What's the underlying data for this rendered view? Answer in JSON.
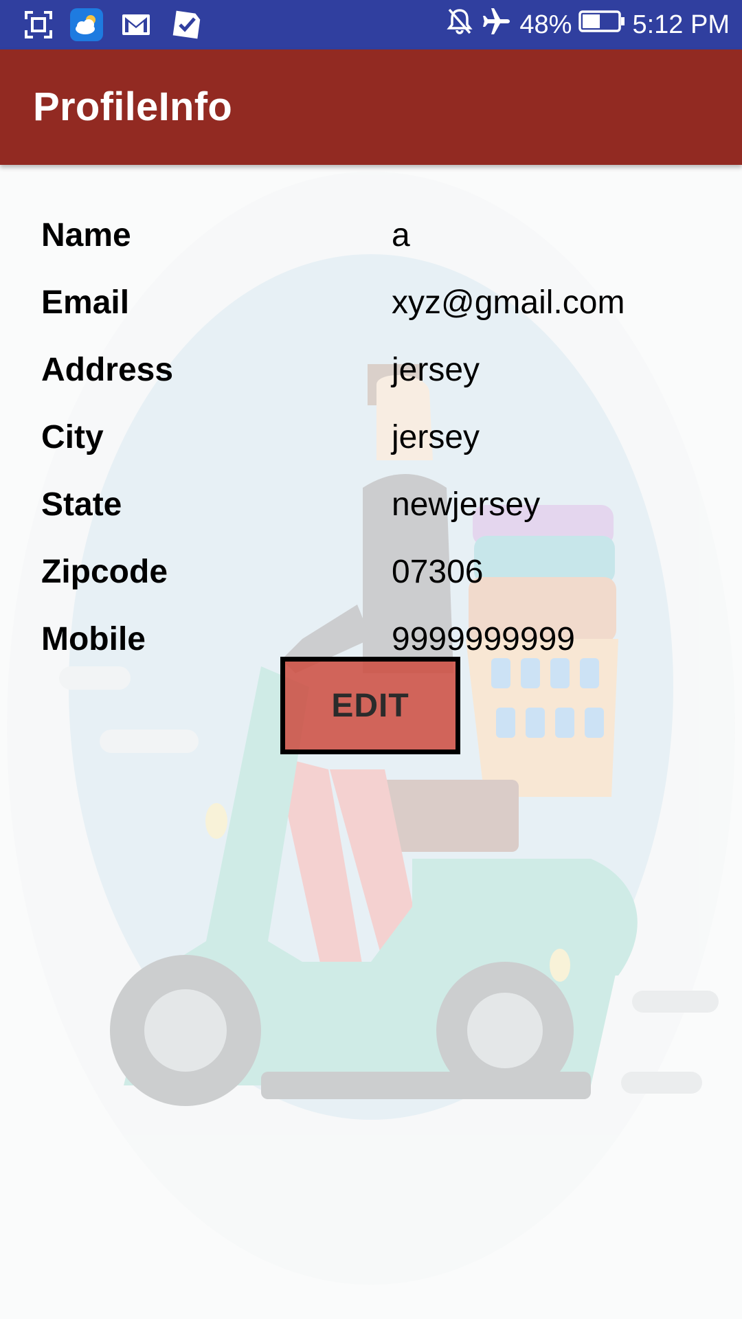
{
  "status_bar": {
    "battery": "48%",
    "time": "5:12 PM",
    "icons": [
      "screenshot-icon",
      "weather-icon",
      "gmail-icon",
      "tasks-icon",
      "notifications-off-icon",
      "airplane-mode-icon",
      "battery-icon"
    ]
  },
  "app_bar": {
    "title": "ProfileInfo"
  },
  "profile": {
    "rows": [
      {
        "label": "Name",
        "value": "a"
      },
      {
        "label": "Email",
        "value": "xyz@gmail.com"
      },
      {
        "label": "Address",
        "value": "jersey"
      },
      {
        "label": "City",
        "value": "jersey"
      },
      {
        "label": "State",
        "value": "newjersey"
      },
      {
        "label": "Zipcode",
        "value": "07306"
      },
      {
        "label": "Mobile",
        "value": "9999999999"
      }
    ]
  },
  "actions": {
    "edit_label": "EDIT"
  },
  "colors": {
    "status_bar": "#303f9f",
    "app_bar": "#922a22",
    "edit_button": "#cd4b3e",
    "background": "#fafbfb"
  }
}
